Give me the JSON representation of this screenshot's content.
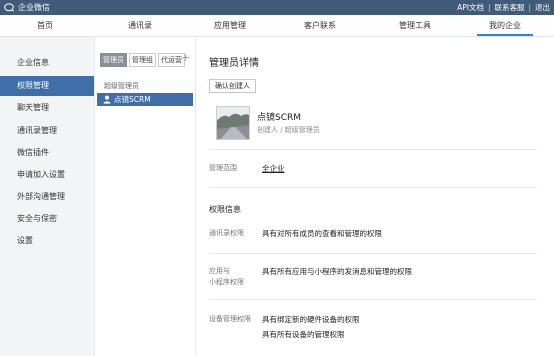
{
  "header": {
    "brand": "企业微信",
    "links": [
      "API文档",
      "联系客服",
      "退出"
    ]
  },
  "nav": {
    "tabs": [
      "首页",
      "通讯录",
      "应用管理",
      "客户联系",
      "管理工具",
      "我的企业"
    ]
  },
  "sidebar": {
    "items": [
      "企业信息",
      "权限管理",
      "聊天管理",
      "通讯录管理",
      "微信插件",
      "申请加入设置",
      "外部沟通管理",
      "安全与保密",
      "设置"
    ]
  },
  "admin_panel": {
    "tabs": [
      "管理员",
      "管理组",
      "代运营"
    ],
    "group_label": "超级管理员",
    "selected_admin": "点镜SCRM"
  },
  "detail": {
    "title": "管理员详情",
    "confirm_button": "确认创建人",
    "name": "点镜SCRM",
    "role": "创建人 / 超级管理员",
    "scope_label": "管理范围",
    "scope_value": "全企业",
    "perm_section": "权限信息",
    "perms": [
      {
        "label_line1": "通讯录权限",
        "label_line2": "",
        "values": [
          "具有对所有成员的查看和管理的权限"
        ]
      },
      {
        "label_line1": "应用与",
        "label_line2": "小程序权限",
        "values": [
          "具有所有应用与小程序的发消息和管理的权限"
        ]
      },
      {
        "label_line1": "设备管理权限",
        "label_line2": "",
        "values": [
          "具有绑定新的硬件设备的权限",
          "具有所有设备的管理权限"
        ]
      }
    ]
  },
  "colors": {
    "topbar": "#3f5b78",
    "accent": "#3f6ea9",
    "nav_underline": "#3b7fd4"
  }
}
